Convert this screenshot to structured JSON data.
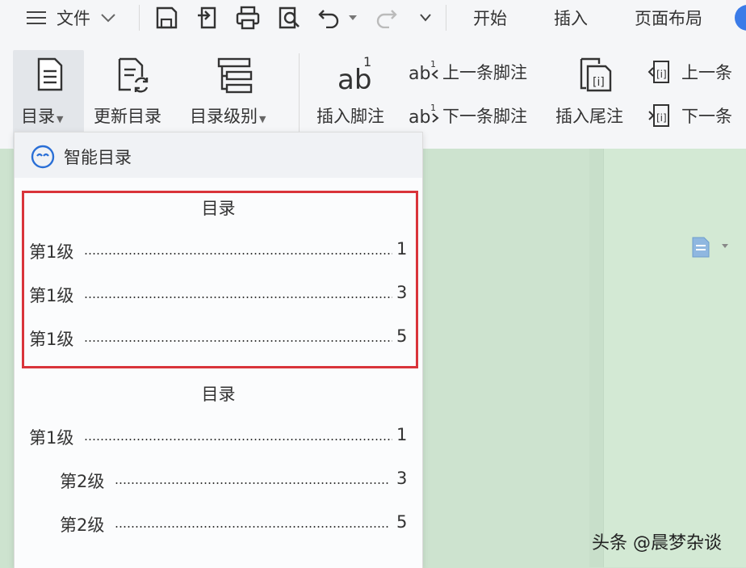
{
  "topbar": {
    "menu_label": "文件",
    "tabs": [
      "开始",
      "插入",
      "页面布局"
    ]
  },
  "ribbon": {
    "toc_label": "目录",
    "update_toc_label": "更新目录",
    "toc_level_label": "目录级别",
    "insert_footnote_label": "插入脚注",
    "prev_footnote_label": "上一条脚注",
    "next_footnote_label": "下一条脚注",
    "insert_endnote_label": "插入尾注",
    "prev_endnote_label": "上一条",
    "next_endnote_label": "下一条"
  },
  "dropdown": {
    "smart_toc_label": "智能目录",
    "templates": [
      {
        "title": "目录",
        "entries": [
          {
            "label": "第1级",
            "page": "1"
          },
          {
            "label": "第1级",
            "page": "3"
          },
          {
            "label": "第1级",
            "page": "5"
          }
        ]
      },
      {
        "title": "目录",
        "entries": [
          {
            "label": "第1级",
            "page": "1"
          },
          {
            "label": "第2级",
            "page": "3"
          },
          {
            "label": "第2级",
            "page": "5"
          }
        ]
      }
    ]
  },
  "watermark": "头条 @晨梦杂谈",
  "colors": {
    "highlight_border": "#d9343a",
    "background": "#cde3cf",
    "smart_icon": "#2a6fd6"
  }
}
